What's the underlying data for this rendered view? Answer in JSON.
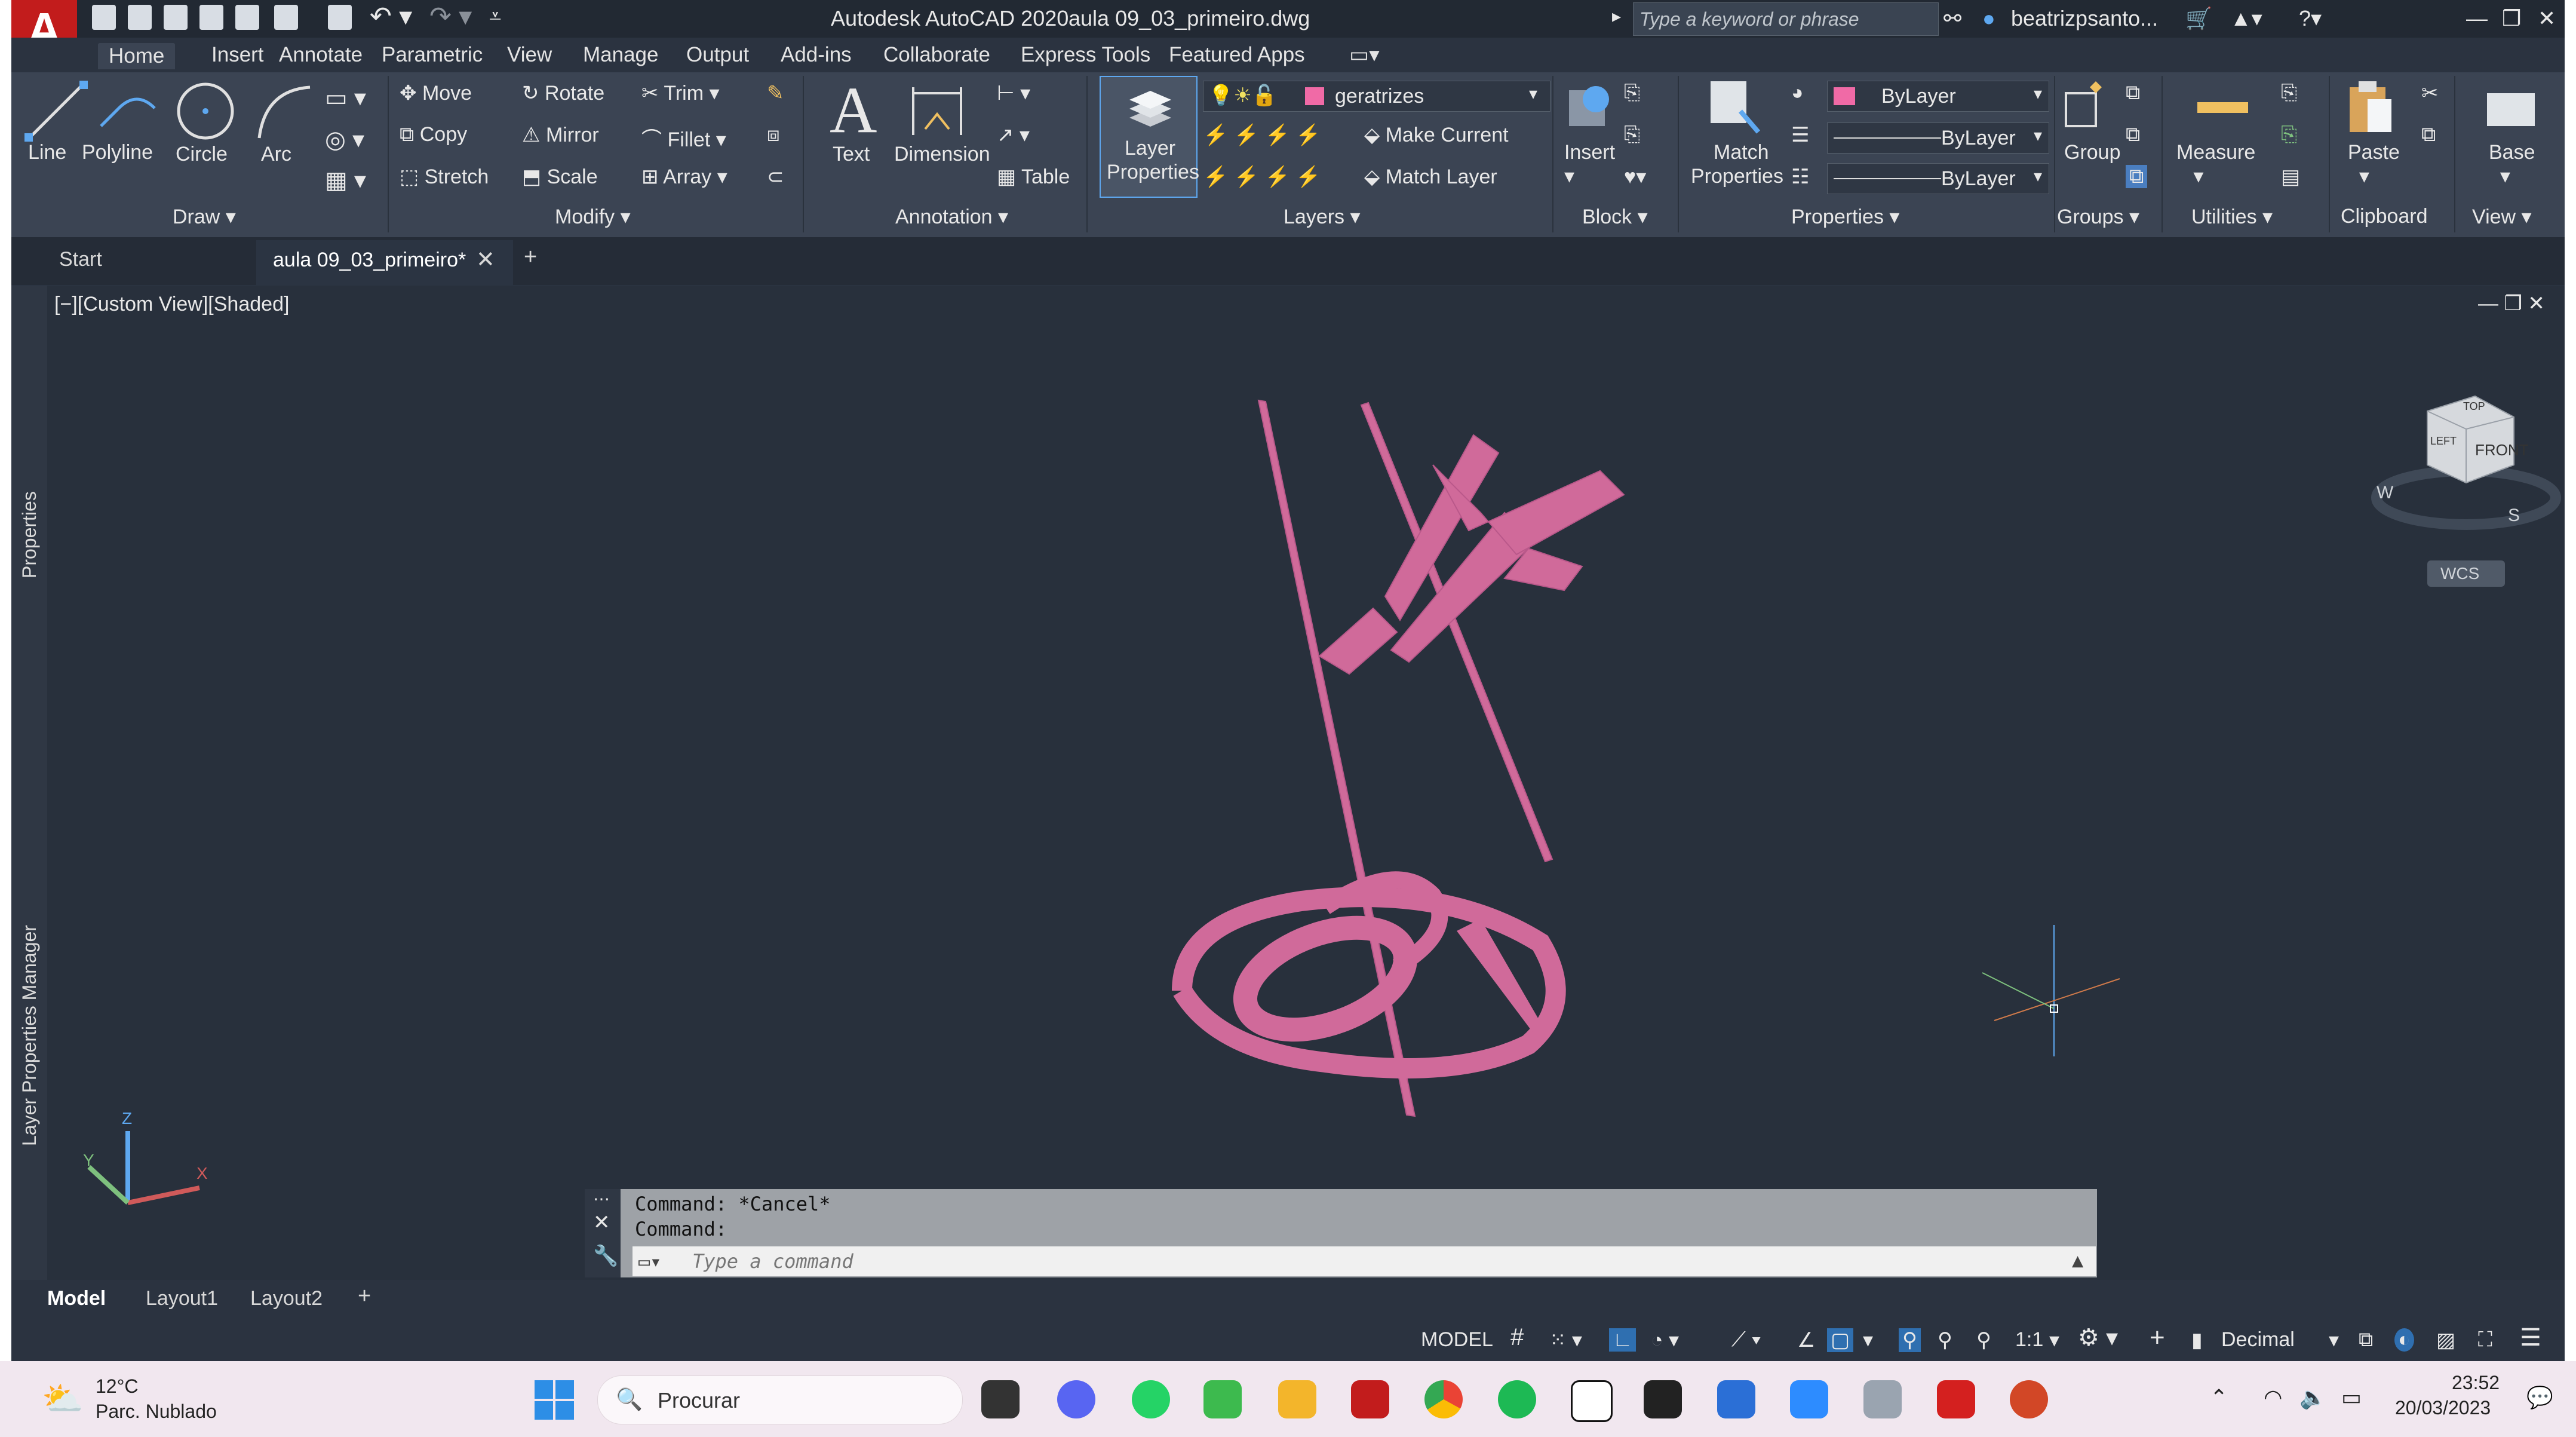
{
  "app": {
    "title": "Autodesk AutoCAD 2020",
    "file": "aula 09_03_primeiro.dwg",
    "search_placeholder": "Type a keyword or phrase",
    "user": "beatrizpsanto..."
  },
  "menu": [
    "Home",
    "Insert",
    "Annotate",
    "Parametric",
    "View",
    "Manage",
    "Output",
    "Add-ins",
    "Collaborate",
    "Express Tools",
    "Featured Apps"
  ],
  "ribbon": {
    "draw": {
      "line": "Line",
      "polyline": "Polyline",
      "circle": "Circle",
      "arc": "Arc",
      "panel": "Draw"
    },
    "modify": {
      "move": "Move",
      "rotate": "Rotate",
      "trim": "Trim",
      "copy": "Copy",
      "mirror": "Mirror",
      "fillet": "Fillet",
      "stretch": "Stretch",
      "scale": "Scale",
      "array": "Array",
      "panel": "Modify"
    },
    "annotation": {
      "text": "Text",
      "dimension": "Dimension",
      "table": "Table",
      "panel": "Annotation"
    },
    "layers": {
      "layer_properties_1": "Layer",
      "layer_properties_2": "Properties",
      "current_layer": "geratrizes",
      "make_current": "Make Current",
      "match_layer": "Match Layer",
      "panel": "Layers"
    },
    "block": {
      "insert": "Insert",
      "panel": "Block"
    },
    "properties": {
      "match_1": "Match",
      "match_2": "Properties",
      "color": "ByLayer",
      "linetype": "ByLayer",
      "lineweight": "ByLayer",
      "panel": "Properties"
    },
    "groups": {
      "group": "Group",
      "panel": "Groups"
    },
    "utilities": {
      "measure": "Measure",
      "panel": "Utilities"
    },
    "clipboard": {
      "paste": "Paste",
      "panel": "Clipboard"
    },
    "view": {
      "base": "Base",
      "panel": "View"
    }
  },
  "doc_tabs": {
    "start": "Start",
    "active": "aula 09_03_primeiro*"
  },
  "viewport": {
    "label": "[−][Custom View][Shaded]",
    "palette_properties": "Properties",
    "palette_layers": "Layer Properties Manager",
    "viewcube_front": "FRONT",
    "viewcube_top": "TOP",
    "viewcube_left": "LEFT",
    "compass_w": "W",
    "compass_s": "S",
    "wcs": "WCS",
    "ucs_z": "Z",
    "ucs_y": "Y",
    "ucs_x": "X"
  },
  "command": {
    "line1": "Command: *Cancel*",
    "line2": "Command:",
    "placeholder": "Type a command"
  },
  "layout_tabs": [
    "Model",
    "Layout1",
    "Layout2"
  ],
  "status": {
    "model": "MODEL",
    "scale": "1:1",
    "units": "Decimal"
  },
  "taskbar": {
    "temp": "12°C",
    "weather": "Parc. Nublado",
    "search": "Procurar",
    "time": "23:52",
    "date": "20/03/2023"
  },
  "colors": {
    "accent": "#2f9be0",
    "geometry": "#d06a9a",
    "layer_swatch": "#f06aa6"
  }
}
